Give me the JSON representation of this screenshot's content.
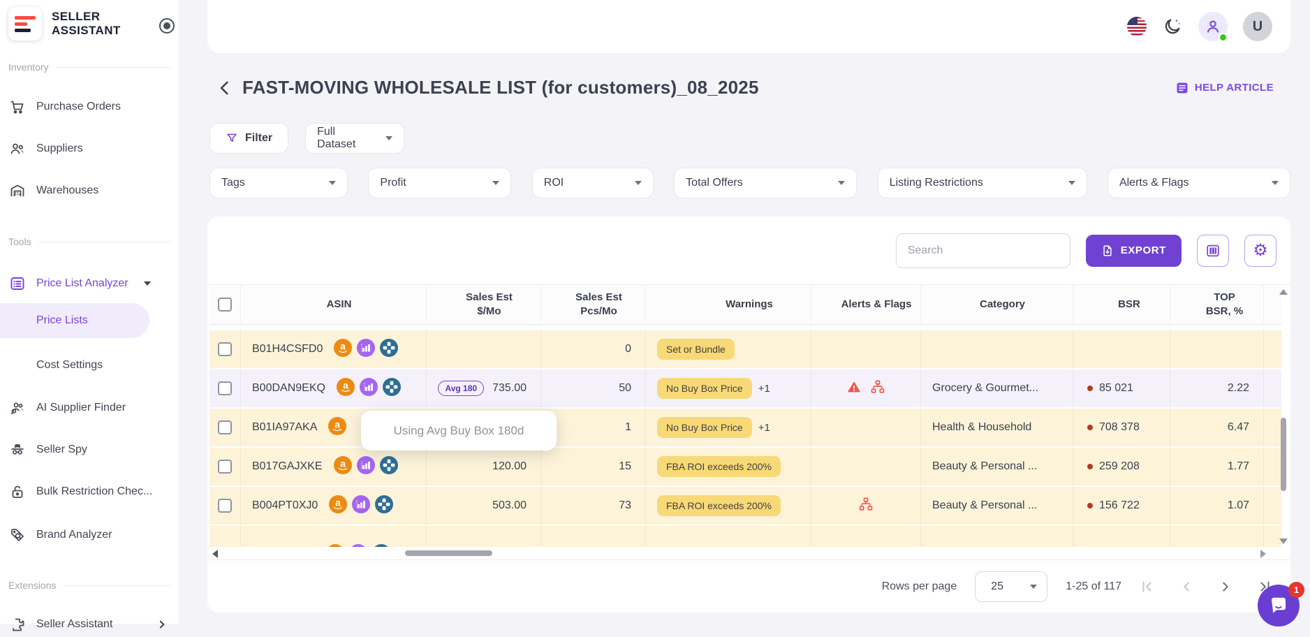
{
  "brand": {
    "line1": "SELLER",
    "line2": "ASSISTANT"
  },
  "sidebar": {
    "sections": [
      {
        "label": "Inventory"
      },
      {
        "label": "Tools"
      },
      {
        "label": "Extensions"
      }
    ],
    "items": {
      "purchase_orders": "Purchase Orders",
      "suppliers": "Suppliers",
      "warehouses": "Warehouses",
      "price_list_analyzer": "Price List Analyzer",
      "price_lists": "Price Lists",
      "cost_settings": "Cost Settings",
      "ai_supplier_finder": "AI Supplier Finder",
      "seller_spy": "Seller Spy",
      "bulk_restriction_checker": "Bulk Restriction Chec...",
      "brand_analyzer": "Brand Analyzer",
      "seller_assistant_ext": "Seller Assistant"
    }
  },
  "topbar": {
    "user_initial": "U"
  },
  "page": {
    "title": "FAST-MOVING WHOLESALE LIST (for customers)_08_2025",
    "help_link": "HELP ARTICLE"
  },
  "filters": {
    "filter_button": "Filter",
    "dataset_value": "Full Dataset",
    "dropdowns": [
      "Tags",
      "Profit",
      "ROI",
      "Total Offers",
      "Listing Restrictions",
      "Alerts & Flags"
    ]
  },
  "toolbar": {
    "search_placeholder": "Search",
    "export_label": "EXPORT"
  },
  "table": {
    "columns": {
      "asin": "ASIN",
      "sales_l1": "Sales Est",
      "sales_l2": "$/Mo",
      "pcs_l1": "Sales Est",
      "pcs_l2": "Pcs/Mo",
      "warnings": "Warnings",
      "alerts": "Alerts & Flags",
      "category": "Category",
      "bsr": "BSR",
      "top_l1": "TOP",
      "top_l2": "BSR, %"
    },
    "rows": [
      {
        "asin": "B01H4CSFD0",
        "avg_badge": "",
        "sales": "",
        "pcs": "0",
        "warning": "Set or Bundle",
        "warning_more": "",
        "category": "",
        "bsr": "",
        "top": ""
      },
      {
        "asin": "B00DAN9EKQ",
        "avg_badge": "Avg 180",
        "sales": "735.00",
        "pcs": "50",
        "warning": "No Buy Box Price",
        "warning_more": "+1",
        "category": "Grocery & Gourmet...",
        "bsr": "85 021",
        "top": "2.22"
      },
      {
        "asin": "B01IA97AKA",
        "avg_badge": "",
        "sales": "",
        "pcs": "1",
        "warning": "No Buy Box Price",
        "warning_more": "+1",
        "category": "Health & Household",
        "bsr": "708 378",
        "top": "6.47"
      },
      {
        "asin": "B017GAJXKE",
        "avg_badge": "",
        "sales": "120.00",
        "pcs": "15",
        "warning": "FBA ROI exceeds 200%",
        "warning_more": "",
        "category": "Beauty & Personal ...",
        "bsr": "259 208",
        "top": "1.77"
      },
      {
        "asin": "B004PT0XJ0",
        "avg_badge": "",
        "sales": "503.00",
        "pcs": "73",
        "warning": "FBA ROI exceeds 200%",
        "warning_more": "",
        "category": "Beauty & Personal ...",
        "bsr": "156 722",
        "top": "1.07"
      }
    ],
    "tooltip": "Using Avg Buy Box 180d"
  },
  "pagination": {
    "rows_per_page_label": "Rows per page",
    "rows_per_page_value": "25",
    "range": "1-25 of 117"
  },
  "chat": {
    "badge": "1"
  },
  "colors": {
    "accent_purple": "#7142d1",
    "sidebar_active_purple": "#7b42d9",
    "warning_badge_bg": "#f8d977",
    "row_yellow": "#fcf3d9",
    "row_lavender": "#f4f1fb",
    "alert_red": "#f2544c",
    "bsr_dot": "#b23b21",
    "logo_red": "#fa4b42",
    "logo_dark": "#1d2133"
  }
}
